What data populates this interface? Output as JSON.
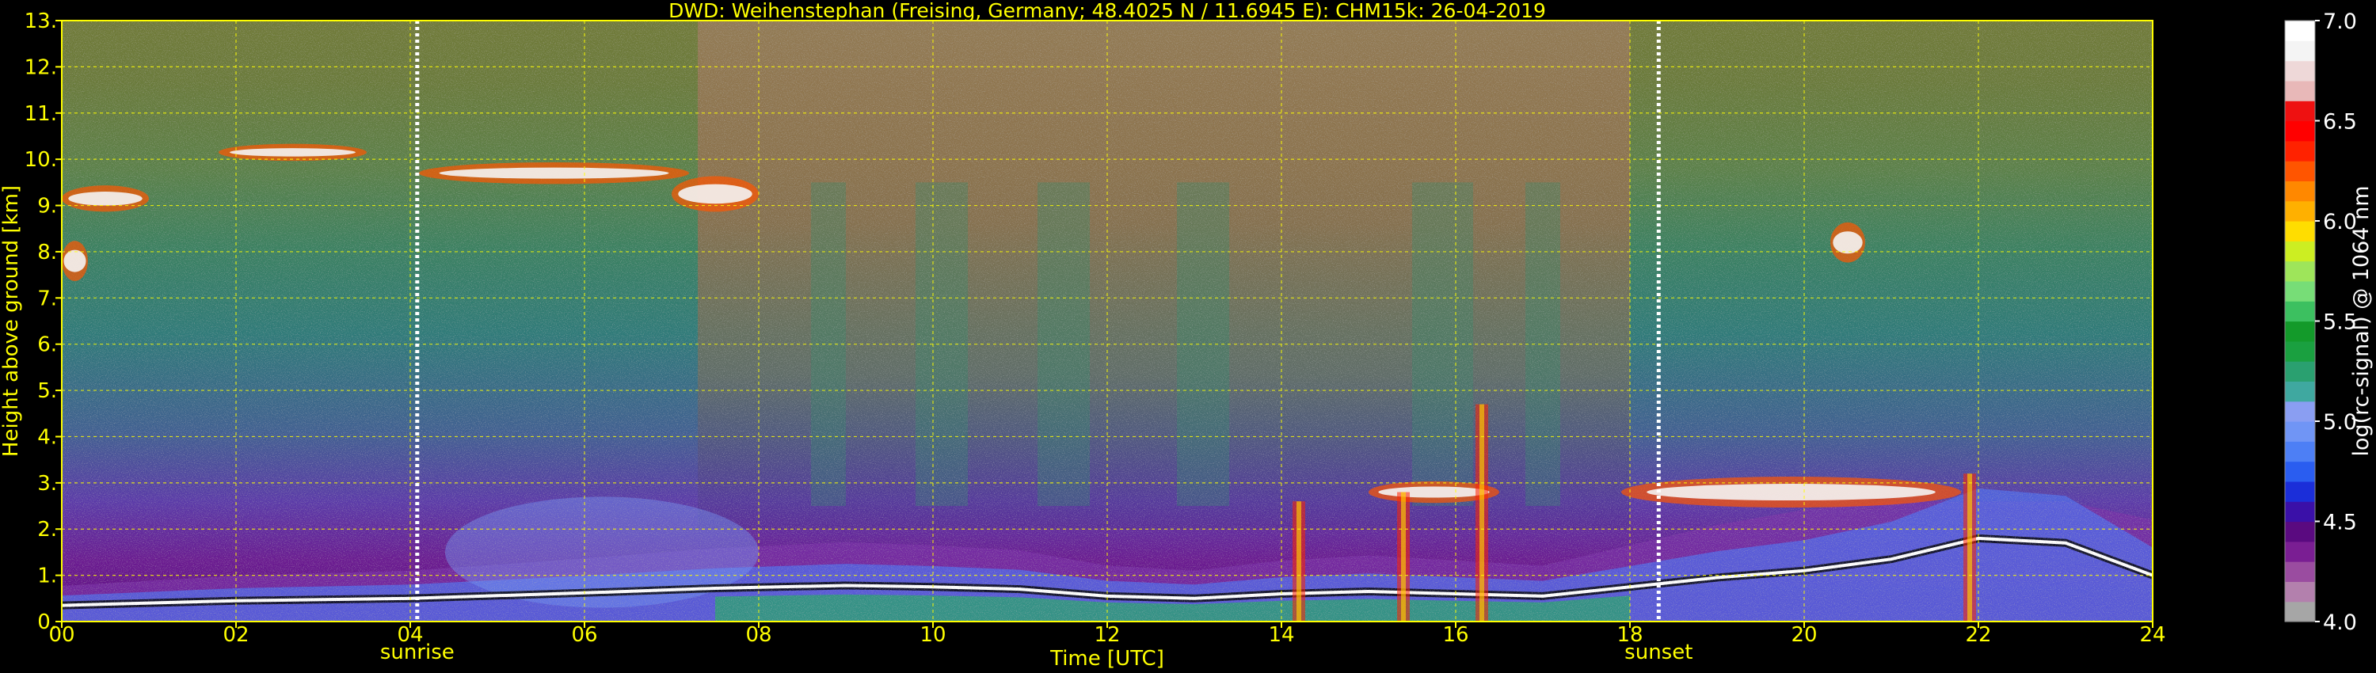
{
  "chart_data": {
    "type": "heatmap",
    "title": "DWD: Weihenstephan (Freising, Germany; 48.4025 N / 11.6945 E):    CHM15k: 26-04-2019",
    "xlabel": "Time [UTC]",
    "ylabel": "Height above ground [km]",
    "xlim": [
      0,
      24
    ],
    "ylim": [
      0,
      13
    ],
    "x_ticks": [
      0,
      2,
      4,
      6,
      8,
      10,
      12,
      14,
      16,
      18,
      20,
      22,
      24
    ],
    "x_tick_labels": [
      "00",
      "02",
      "04",
      "06",
      "08",
      "10",
      "12",
      "14",
      "16",
      "18",
      "20",
      "22",
      "24"
    ],
    "y_ticks": [
      0,
      1,
      2,
      3,
      4,
      5,
      6,
      7,
      8,
      9,
      10,
      11,
      12,
      13
    ],
    "y_tick_labels": [
      "0.",
      "1.",
      "2.",
      "3.",
      "4.",
      "5.",
      "6.",
      "7.",
      "8.",
      "9.",
      "10.",
      "11.",
      "12.",
      "13."
    ],
    "grid": true,
    "markers": [
      {
        "label": "sunrise",
        "x": 4.08
      },
      {
        "label": "sunset",
        "x": 18.33
      }
    ],
    "colorbar": {
      "label": "log(rc-signal) @ 1064 nm",
      "range": [
        4.0,
        7.0
      ],
      "ticks": [
        4.0,
        4.5,
        5.0,
        5.5,
        6.0,
        6.5,
        7.0
      ],
      "tick_labels": [
        "4.0",
        "4.5",
        "5.0",
        "5.5",
        "6.0",
        "6.5",
        "7.0"
      ],
      "colors": [
        "#a6a6a6",
        "#b380ad",
        "#9a4ca0",
        "#7a1e93",
        "#5a0a80",
        "#3a10a8",
        "#1b2ed9",
        "#2a5df0",
        "#4d7ff5",
        "#7095f5",
        "#8a9ef2",
        "#3fa8a0",
        "#2aa070",
        "#1aa040",
        "#139a2a",
        "#3cc060",
        "#77dd77",
        "#9ee55a",
        "#ccee22",
        "#ffdd00",
        "#ffb000",
        "#ff8800",
        "#ff5500",
        "#ff2200",
        "#ff0000",
        "#ee1111",
        "#e8b8b8",
        "#eed8d8",
        "#f4f4f4",
        "#ffffff"
      ]
    },
    "features": {
      "boundary_layer_top_km": [
        [
          0,
          0.35
        ],
        [
          2,
          0.45
        ],
        [
          4,
          0.5
        ],
        [
          6,
          0.62
        ],
        [
          7.5,
          0.72
        ],
        [
          8,
          0.74
        ],
        [
          9,
          0.78
        ],
        [
          10,
          0.75
        ],
        [
          11,
          0.7
        ],
        [
          12,
          0.55
        ],
        [
          13,
          0.5
        ],
        [
          14,
          0.6
        ],
        [
          15,
          0.65
        ],
        [
          16,
          0.6
        ],
        [
          17,
          0.55
        ],
        [
          18,
          0.75
        ],
        [
          19,
          0.95
        ],
        [
          20,
          1.1
        ],
        [
          21,
          1.35
        ],
        [
          22,
          1.8
        ],
        [
          23,
          1.7
        ],
        [
          24,
          1.0
        ]
      ],
      "cloud_layers": [
        {
          "x_start": 1.8,
          "x_end": 3.5,
          "base_km": 10.0,
          "top_km": 10.3
        },
        {
          "x_start": 4.1,
          "x_end": 7.2,
          "base_km": 9.5,
          "top_km": 9.9
        },
        {
          "x_start": 7.0,
          "x_end": 8.0,
          "base_km": 8.9,
          "top_km": 9.6
        },
        {
          "x_start": 0.0,
          "x_end": 1.0,
          "base_km": 8.9,
          "top_km": 9.4
        },
        {
          "x_start": 0.0,
          "x_end": 0.3,
          "base_km": 7.4,
          "top_km": 8.2
        },
        {
          "x_start": 15.0,
          "x_end": 16.5,
          "base_km": 2.6,
          "top_km": 3.0
        },
        {
          "x_start": 17.9,
          "x_end": 21.8,
          "base_km": 2.5,
          "top_km": 3.1
        },
        {
          "x_start": 20.3,
          "x_end": 20.7,
          "base_km": 7.8,
          "top_km": 8.6
        }
      ],
      "precipitation_streaks": [
        {
          "x": 14.2,
          "top_km": 2.6
        },
        {
          "x": 15.4,
          "top_km": 2.8
        },
        {
          "x": 16.3,
          "top_km": 4.7
        },
        {
          "x": 21.9,
          "top_km": 3.2
        }
      ]
    }
  }
}
